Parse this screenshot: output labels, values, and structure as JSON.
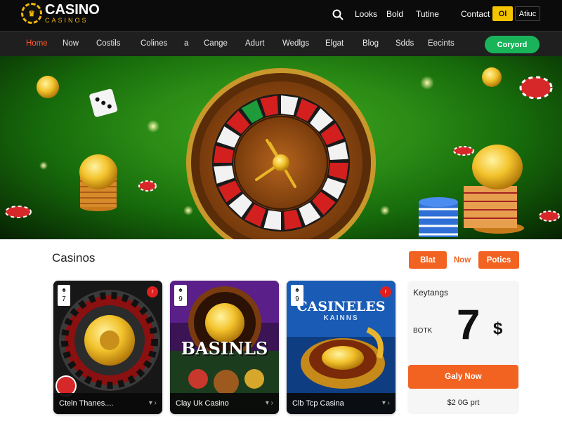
{
  "header": {
    "logo_main": "CASINO",
    "logo_sub": "CASINOS",
    "links": [
      "Looks",
      "Bold",
      "Tutine",
      "Contact"
    ],
    "flag_label": "Ol",
    "lang_label": "Atiuc"
  },
  "nav": {
    "items": [
      "Home",
      "Now",
      "Costils",
      "Colines",
      "a",
      "Cange",
      "Adurt",
      "Wedlgs",
      "Elgat",
      "Blog",
      "Sdds",
      "Eecints"
    ],
    "active_index": 0,
    "cta_label": "Coryord"
  },
  "section": {
    "title": "Casinos",
    "tabs": [
      "Blat",
      "Now",
      "Potics"
    ]
  },
  "cards": [
    {
      "label": "Cteln Thanes....",
      "pc": "7",
      "badge": "r",
      "title": ""
    },
    {
      "label": "Clay Uk Casino",
      "pc": "9",
      "badge": "r",
      "title": "BASINLS"
    },
    {
      "label": "Clb Tcp Casina",
      "pc": "9",
      "badge": "r",
      "title": "CASINELES",
      "subtitle": "KAINNS"
    }
  ],
  "side": {
    "label": "Keytangs",
    "small": "BOTK",
    "big": "7",
    "currency": "$",
    "button": "Galy Now",
    "footer": "$2 0G prt"
  },
  "colors": {
    "accent": "#f26322",
    "nav_cta": "#19b35a",
    "flag": "#f5c400",
    "nav_active": "#ff5a2a"
  }
}
